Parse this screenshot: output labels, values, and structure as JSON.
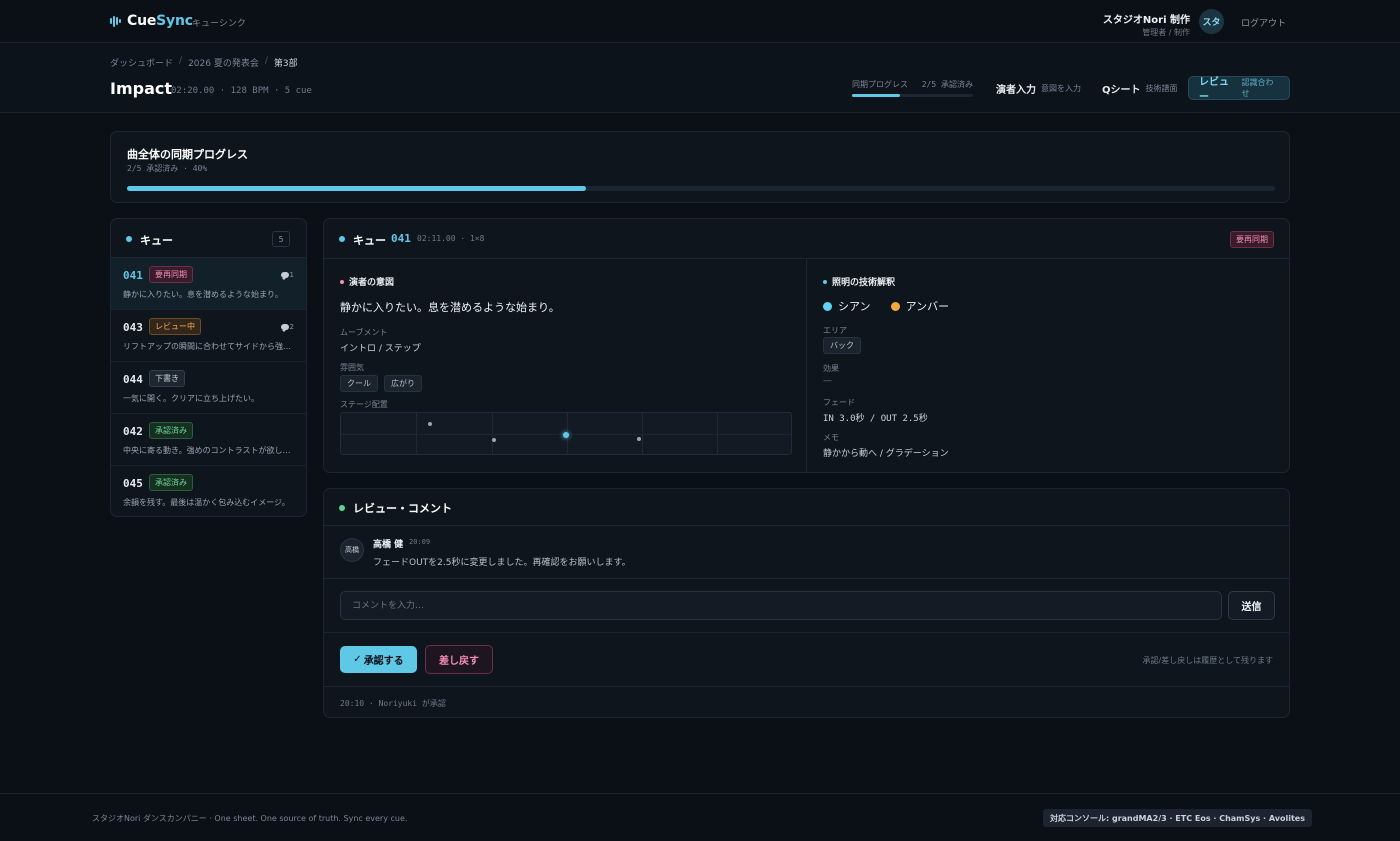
{
  "app": {
    "logo_prefix": "Cue",
    "logo_suffix": "Sync",
    "subtitle": "キューシンク",
    "user_name": "スタジオNori 制作",
    "user_role": "管理者 / 制作",
    "avatar_initials": "スタ",
    "logout_label": "ログアウト"
  },
  "breadcrumb": [
    "ダッシュボード",
    "2026 夏の発表会",
    "第3部"
  ],
  "page": {
    "title": "Impact",
    "meta": "02:20.00 · 128 BPM · 5 cue"
  },
  "sync_mini": {
    "label": "同期プログレス",
    "status": "2/5 承認済み",
    "progress": 0.4
  },
  "nav": {
    "input_label": "演者入力",
    "input_sub": "意図を入力",
    "qsheet_label": "Qシート",
    "qsheet_sub": "技術譜面",
    "review_label": "レビュー",
    "review_sub": "認識合わせ"
  },
  "progress_card": {
    "title": "曲全体の同期プログレス",
    "status": "2/5 承認済み · 40%",
    "progress": 0.4
  },
  "queue": {
    "title": "キュー",
    "count": "5",
    "items": [
      {
        "num": "041",
        "status": "要再同期",
        "status_type": "resync",
        "desc": "静かに入りたい。息を潜めるような始まり。",
        "comments": "1",
        "active": true
      },
      {
        "num": "043",
        "status": "レビュー中",
        "status_type": "review",
        "desc": "リフトアップの瞬間に合わせてサイドから強く当てたい。",
        "comments": "2",
        "active": false
      },
      {
        "num": "044",
        "status": "下書き",
        "status_type": "draft",
        "desc": "一気に開く。クリアに立ち上げたい。",
        "comments": "",
        "active": false
      },
      {
        "num": "042",
        "status": "承認済み",
        "status_type": "ok",
        "desc": "中央に寄る動き。強めのコントラストが欲しい。",
        "comments": "",
        "active": false
      },
      {
        "num": "045",
        "status": "承認済み",
        "status_type": "ok",
        "desc": "余韻を残す。最後は温かく包み込むイメージ。",
        "comments": "",
        "active": false
      }
    ]
  },
  "detail": {
    "label": "キュー",
    "num": "041",
    "meta": "02:11.00 · 1×8",
    "badge": "要再同期",
    "left_title": "演者の意図",
    "intent": "静かに入りたい。息を潜めるような始まり。",
    "movement_label": "ムーブメント",
    "movement_value": "イントロ / ステップ",
    "mood_label": "雰囲気",
    "mood_chips": [
      "クール",
      "広がり"
    ],
    "stage_label": "ステージ配置",
    "right_title": "照明の技術解釈",
    "colors": [
      {
        "name": "シアン",
        "hex": "#5fd3ef"
      },
      {
        "name": "アンバー",
        "hex": "#f2a93b"
      }
    ],
    "area_label": "エリア",
    "area_value": "バック",
    "effect_label": "効果",
    "effect_value": "—",
    "fade_label": "フェード",
    "fade_value": "IN 3.0秒 / OUT 2.5秒",
    "memo_label": "メモ",
    "memo_value": "静かから動へ / グラデーション"
  },
  "review": {
    "title": "レビュー・コメント",
    "comment_avatar": "高橋",
    "comment_author": "高橋 健",
    "comment_time": "20:09",
    "comment_text": "フェードOUTを2.5秒に変更しました。再確認をお願いします。",
    "input_placeholder": "コメントを入力…",
    "send_label": "送信",
    "approve_label": "承認する",
    "reject_label": "差し戻す",
    "action_note": "承認/差し戻しは履歴として残ります",
    "history": "20:10 · Noriyuki が承認"
  },
  "footer": {
    "left": "スタジオNori ダンスカンパニー · One sheet. One source of truth. Sync every cue.",
    "right": "対応コンソール: grandMA2/3 · ETC Eos · ChamSys · Avolites"
  },
  "colors": {
    "accent": "#5fc8e6",
    "resync": "#f08fb6",
    "review": "#f2b258",
    "approved": "#6fd6a0"
  }
}
